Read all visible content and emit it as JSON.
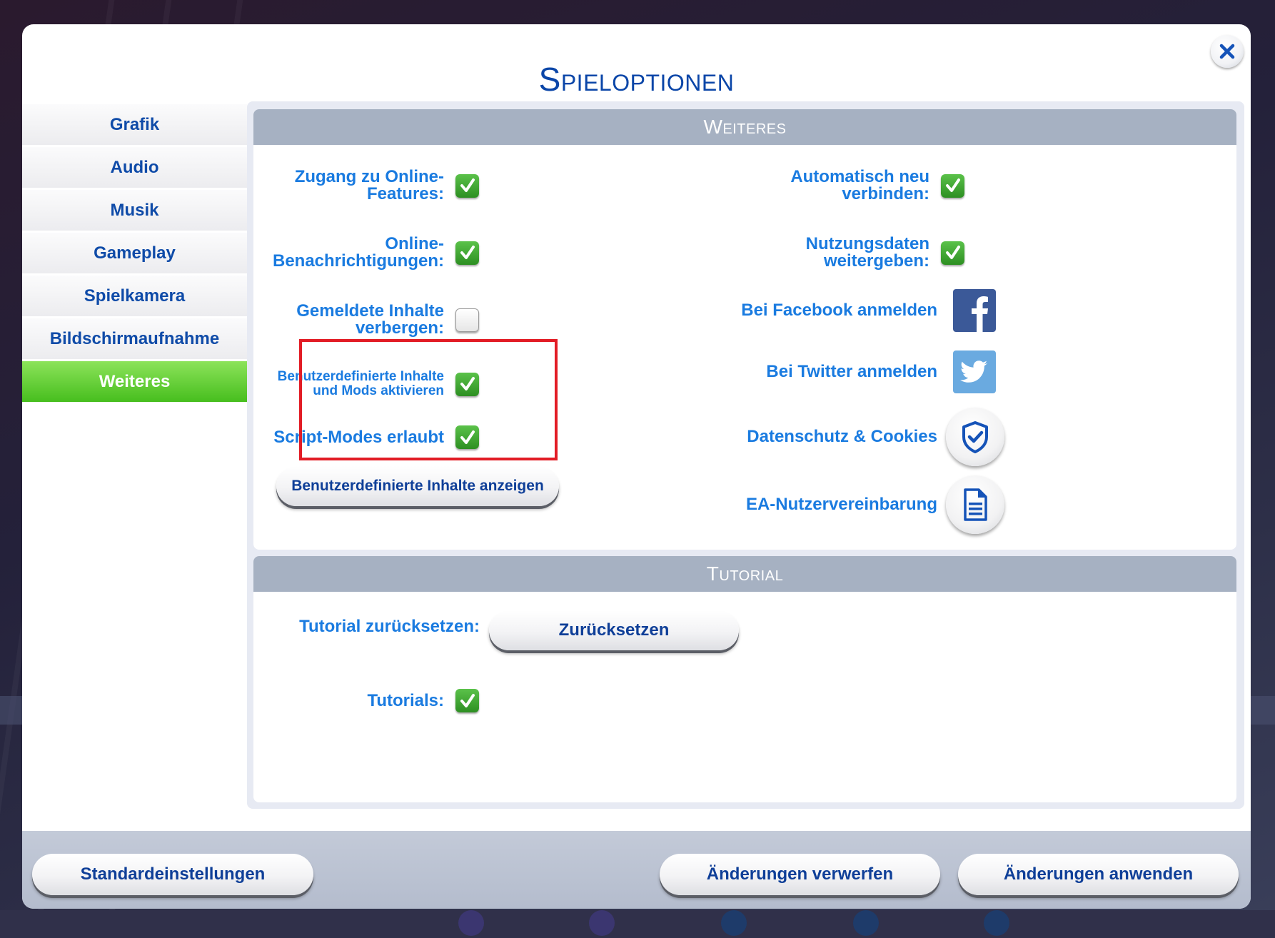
{
  "dialog": {
    "title": "Spieloptionen",
    "close_icon": "close-icon"
  },
  "sidebar": {
    "items": [
      {
        "label": "Grafik",
        "active": false
      },
      {
        "label": "Audio",
        "active": false
      },
      {
        "label": "Musik",
        "active": false
      },
      {
        "label": "Gameplay",
        "active": false
      },
      {
        "label": "Spielkamera",
        "active": false
      },
      {
        "label": "Bildschirmaufnahme",
        "active": false
      },
      {
        "label": "Weiteres",
        "active": true
      }
    ]
  },
  "weiteres": {
    "header": "Weiteres",
    "left_options": [
      {
        "label": "Zugang zu Online-\nFeatures:",
        "checked": true
      },
      {
        "label": "Online-\nBenachrichtigungen:",
        "checked": true
      },
      {
        "label": "Gemeldete Inhalte\nverbergen:",
        "checked": false
      },
      {
        "label": "Benutzerdefinierte Inhalte\nund Mods aktivieren",
        "checked": true
      },
      {
        "label": "Script-Modes erlaubt",
        "checked": true
      }
    ],
    "show_custom_content_button": "Benutzerdefinierte Inhalte anzeigen",
    "right_options": [
      {
        "label": "Automatisch neu\nverbinden:",
        "checked": true
      },
      {
        "label": "Nutzungsdaten\nweitergeben:",
        "checked": true
      }
    ],
    "links": [
      {
        "label": "Bei Facebook anmelden",
        "icon": "facebook-icon"
      },
      {
        "label": "Bei Twitter anmelden",
        "icon": "twitter-icon"
      },
      {
        "label": "Datenschutz & Cookies",
        "icon": "shield-check-icon"
      },
      {
        "label": "EA-Nutzervereinbarung",
        "icon": "document-icon"
      }
    ]
  },
  "tutorial": {
    "header": "Tutorial",
    "reset_label": "Tutorial zurücksetzen:",
    "reset_button": "Zurücksetzen",
    "tutorials_label": "Tutorials:",
    "tutorials_checked": true
  },
  "footer": {
    "defaults_button": "Standardeinstellungen",
    "discard_button": "Änderungen verwerfen",
    "apply_button": "Änderungen anwenden"
  },
  "colors": {
    "accent_blue": "#0b46a8",
    "label_blue": "#1a7be0",
    "active_green": "#47be1e",
    "section_header": "#a6b1c2",
    "highlight_red": "#e21c25"
  }
}
